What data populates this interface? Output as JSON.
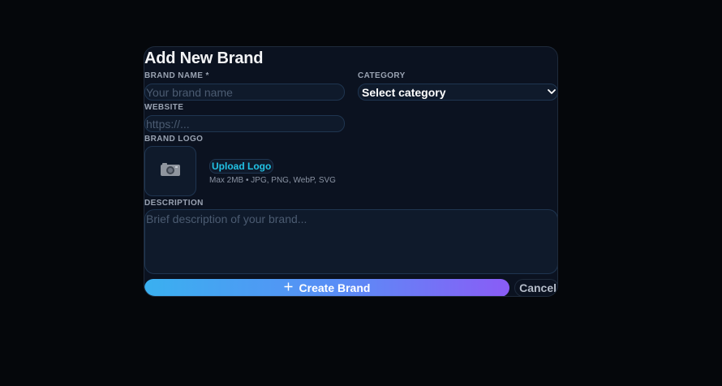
{
  "modal": {
    "title": "Add New Brand"
  },
  "form": {
    "brand_name": {
      "label": "BRAND NAME *",
      "placeholder": "Your brand name",
      "value": ""
    },
    "category": {
      "label": "CATEGORY",
      "selected": "Select category"
    },
    "website": {
      "label": "WEBSITE",
      "placeholder": "https://...",
      "value": ""
    },
    "brand_logo": {
      "label": "BRAND LOGO",
      "icon": "camera-icon",
      "upload_label": "Upload Logo",
      "hint": "Max 2MB • JPG, PNG, WebP, SVG"
    },
    "description": {
      "label": "DESCRIPTION",
      "placeholder": "Brief description of your brand...",
      "value": ""
    }
  },
  "actions": {
    "create_icon": "plus-icon",
    "create_label": "Create Brand",
    "cancel_label": "Cancel"
  },
  "colors": {
    "background": "#05070b",
    "modal_bg": "#0b1220",
    "field_bg": "#0f1a2b",
    "accent_cyan": "#22c3e6",
    "gradient_start": "#3ab0f0",
    "gradient_end": "#8a5cf6"
  }
}
